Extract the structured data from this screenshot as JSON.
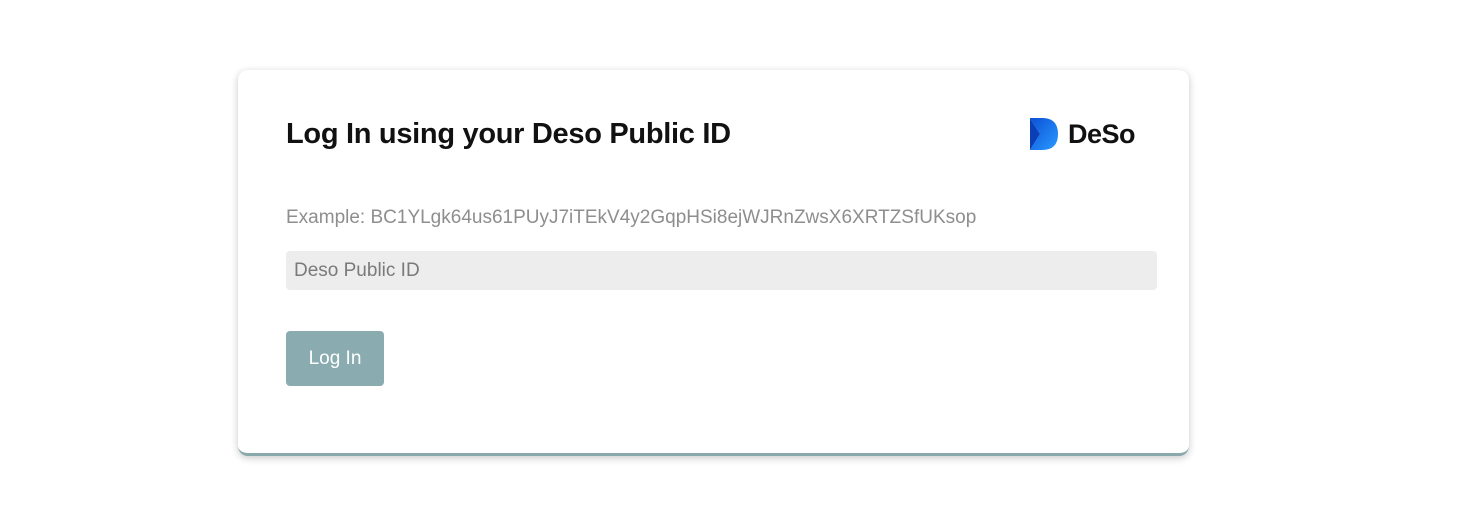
{
  "login": {
    "title": "Log In using your Deso Public ID",
    "example_text": "Example: BC1YLgk64us61PUyJ7iTEkV4y2GqpHSi8ejWJRnZwsX6XRTZSfUKsop",
    "input_placeholder": "Deso Public ID",
    "input_value": "",
    "button_label": "Log In"
  },
  "brand": {
    "logo_text": "DeSo",
    "logo_icon": "deso-logo-icon",
    "logo_color": "#1a73f5"
  },
  "colors": {
    "button_bg": "#8aabb0",
    "card_border_accent": "#8aa9ad",
    "input_bg": "#ededed"
  }
}
